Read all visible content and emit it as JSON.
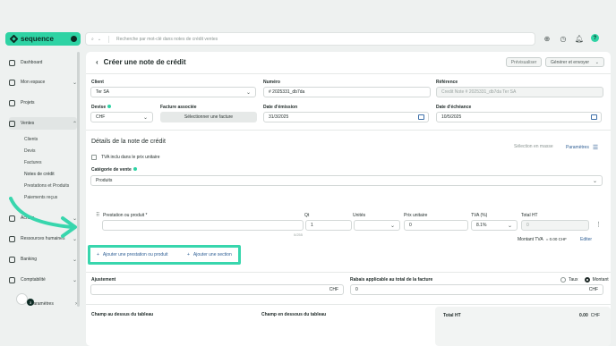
{
  "app": {
    "brand": "sequence"
  },
  "search": {
    "placeholder": "Recherche par mot-clé dans notes de crédit ventes"
  },
  "sidebar": {
    "items": [
      {
        "label": "Dashboard"
      },
      {
        "label": "Mon espace"
      },
      {
        "label": "Projets"
      },
      {
        "label": "Ventes"
      },
      {
        "label": "Achats"
      },
      {
        "label": "Ressources humaines"
      },
      {
        "label": "Banking"
      },
      {
        "label": "Comptabilité"
      },
      {
        "label": "Paramètres"
      }
    ],
    "sub_items": [
      {
        "label": "Clients"
      },
      {
        "label": "Devis"
      },
      {
        "label": "Factures"
      },
      {
        "label": "Notes de crédit"
      },
      {
        "label": "Prestations et Produits"
      },
      {
        "label": "Paiements reçus"
      }
    ],
    "avatar_badge": "3"
  },
  "page": {
    "title": "Créer une note de crédit",
    "preview_label": "Prévisualiser",
    "generate_label": "Générer et envoyer"
  },
  "form": {
    "client_label": "Client",
    "client_value": "Ter SA",
    "numero_label": "Numéro",
    "numero_value": "# 2025331_db7da",
    "reference_label": "Référence",
    "reference_placeholder": "Credit Note # 2025331_db7da Ter SA",
    "devise_label": "Devise",
    "devise_value": "CHF",
    "facture_label": "Facture associée",
    "facture_button": "Sélectionner une facture",
    "date_emission_label": "Date d'émission",
    "date_emission_value": "31/3/2025",
    "date_echeance_label": "Date d'échéance",
    "date_echeance_value": "10/5/2025"
  },
  "details": {
    "title": "Détails de la note de crédit",
    "currency_selection": "Sélection en masse",
    "parametres_label": "Paramètres",
    "tva_checkbox_label": "TVA inclu dans le prix unitaire",
    "categorie_label": "Catégorie de vente",
    "categorie_value": "Produits"
  },
  "line_table": {
    "headers": [
      "Prestation ou produit *",
      "Qt",
      "Unités",
      "Prix unitaire",
      "TVA (%)",
      "Total HT"
    ],
    "row": {
      "qt": "1",
      "prix": "0",
      "tva": "8.1%",
      "total": "0"
    },
    "char_count": "0/255",
    "montant_tva_label": "Montant TVA",
    "montant_tva_value": "= 0.00 CHF",
    "edit_label": "Editer"
  },
  "actions": {
    "add_item": "Ajouter une prestation ou produit",
    "add_section": "Ajouter une section"
  },
  "adjustments": {
    "ajustement_label": "Ajustement",
    "ajustement_unit": "CHF",
    "rabais_label": "Rabais applicable au total de la facture",
    "rabais_value": "0",
    "rabais_unit": "CHF",
    "taux_label": "Taux",
    "montant_label": "Montant"
  },
  "footer_fields": {
    "above_table": "Champ au dessus du tableau",
    "below_table": "Champ en dessous du tableau",
    "total_ht_label": "Total HT",
    "total_ht_value": "0.00",
    "total_ht_currency": "CHF"
  },
  "colors": {
    "accent": "#2ed3a4",
    "highlight": "#38d6ad",
    "link": "#2f5f95"
  }
}
